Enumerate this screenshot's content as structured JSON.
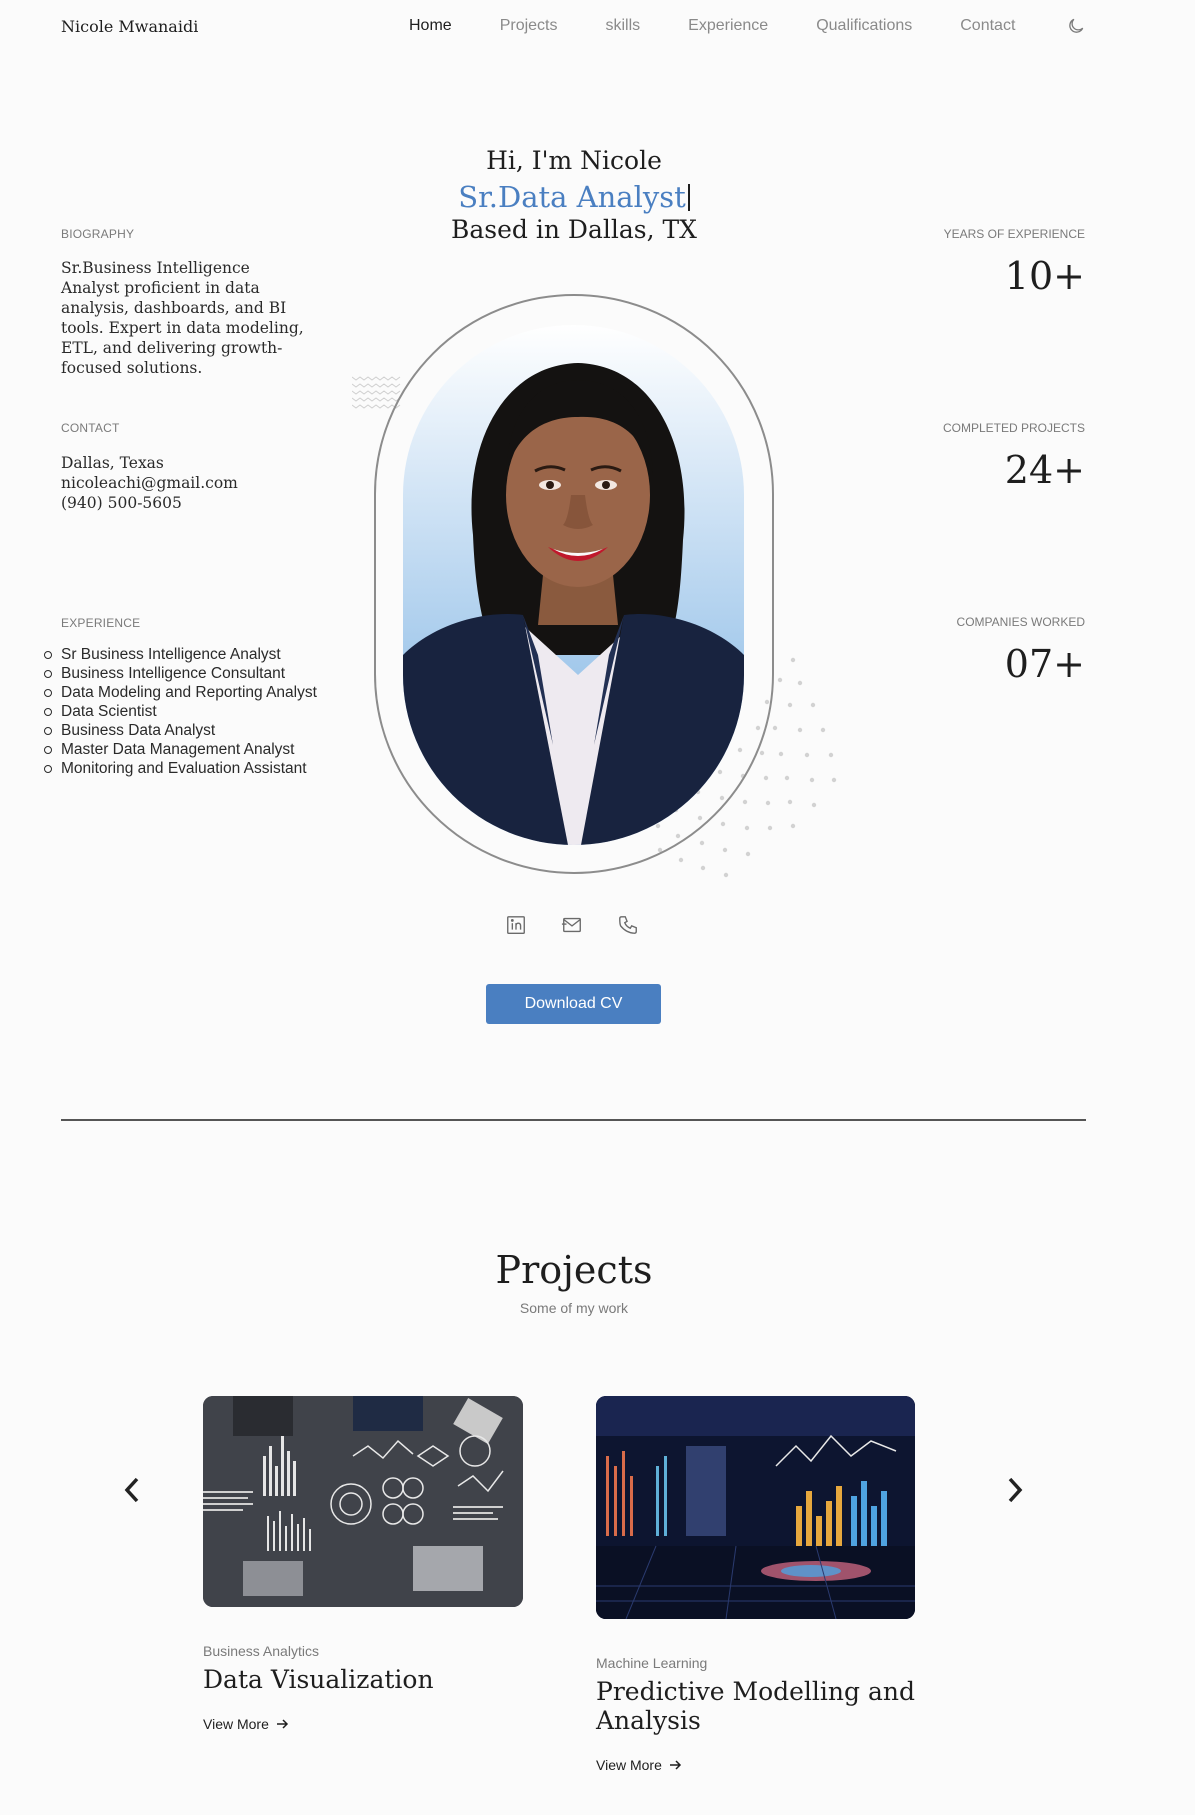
{
  "nav": {
    "brand": "Nicole Mwanaidi",
    "links": [
      "Home",
      "Projects",
      "skills",
      "Experience",
      "Qualifications",
      "Contact"
    ],
    "active": "Home",
    "theme_icon": "moon-icon"
  },
  "hero": {
    "greeting": "Hi, I'm Nicole",
    "role": "Sr.Data Analyst",
    "location": "Based in Dallas, TX"
  },
  "biography": {
    "label": "BIOGRAPHY",
    "text": "Sr.Business Intelligence Analyst proficient in data analysis, dashboards, and BI tools. Expert in data modeling, ETL, and delivering growth-focused solutions."
  },
  "contact": {
    "label": "CONTACT",
    "city": "Dallas, Texas",
    "email": "nicoleachi@gmail.com",
    "phone": "(940) 500-5605"
  },
  "experience": {
    "label": "EXPERIENCE",
    "items": [
      "Sr Business Intelligence Analyst",
      "Business Intelligence Consultant",
      "Data Modeling and Reporting Analyst",
      "Data Scientist",
      "Business Data Analyst",
      "Master Data Management Analyst",
      "Monitoring and Evaluation Assistant"
    ]
  },
  "stats": [
    {
      "label": "YEARS OF EXPERIENCE",
      "value": "10+"
    },
    {
      "label": "COMPLETED PROJECTS",
      "value": "24+"
    },
    {
      "label": "COMPANIES WORKED",
      "value": "07+"
    }
  ],
  "socials": [
    "linkedin-icon",
    "mail-icon",
    "phone-icon"
  ],
  "cta": {
    "download_cv": "Download CV"
  },
  "projects": {
    "title": "Projects",
    "subtitle": "Some of my work",
    "cards": [
      {
        "category": "Business Analytics",
        "title": "Data Visualization",
        "link": "View More"
      },
      {
        "category": "Machine Learning",
        "title": "Predictive Modelling and Analysis",
        "link": "View More"
      }
    ]
  },
  "colors": {
    "accent": "#4a7fc1",
    "text": "#1e1e1e",
    "muted": "#7a7a7a",
    "background": "#fbfbfb"
  }
}
